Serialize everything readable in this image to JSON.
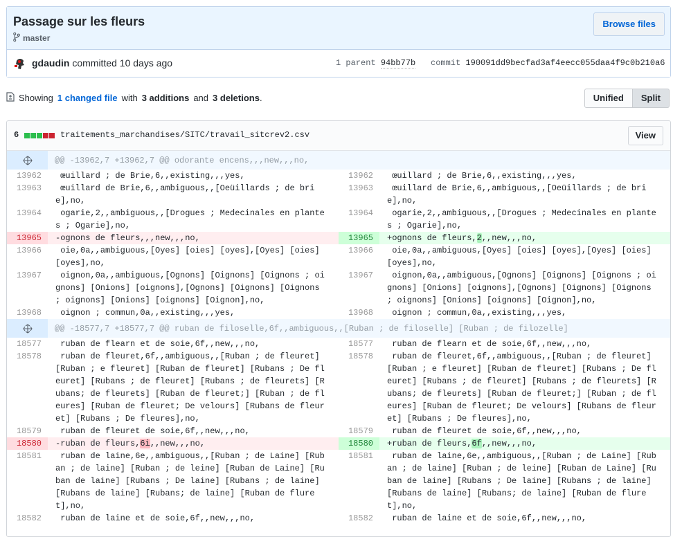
{
  "commit": {
    "title": "Passage sur les fleurs",
    "branch": "master",
    "browse_label": "Browse files",
    "author": "gdaudin",
    "committed_text": "committed 10 days ago",
    "parent_label": "1 parent",
    "parent_sha": "94bb77b",
    "commit_label": "commit",
    "commit_sha": "190091dd9becfad3af4eecc055daa4f9c0b210a6"
  },
  "toc": {
    "showing": "Showing",
    "changed": "1 changed file",
    "with": "with",
    "additions": "3 additions",
    "and": "and",
    "deletions": "3 deletions",
    "period": ".",
    "unified_label": "Unified",
    "split_label": "Split"
  },
  "file": {
    "count": "6",
    "path": "traitements_marchandises/SITC/travail_sitcrev2.csv",
    "view_label": "View",
    "diffstat_colors": [
      "#2cbe4e",
      "#2cbe4e",
      "#2cbe4e",
      "#cb2431",
      "#cb2431"
    ]
  },
  "hunk1": {
    "header": "@@ -13962,7 +13962,7 @@ odorante encens,,,new,,,no,",
    "rows": [
      {
        "ln": "13962",
        "l": " œuillard ; de Brie,6,,existing,,,yes,",
        "r": " œuillard ; de Brie,6,,existing,,,yes,"
      },
      {
        "ln": "13963",
        "l": " œuillard de Brie,6,,ambiguous,,[Oeüillards ; de brie],no,",
        "r": " œuillard de Brie,6,,ambiguous,,[Oeüillards ; de brie],no,"
      },
      {
        "ln": "13964",
        "l": " ogarie,2,,ambiguous,,[Drogues ; Medecinales en plantes ; Ogarie],no,",
        "r": " ogarie,2,,ambiguous,,[Drogues ; Medecinales en plantes ; Ogarie],no,"
      },
      {
        "ln": "13965",
        "pre": "-ognons de fleurs,",
        "hl": "",
        "post": ",,new,,,no,",
        "rpre": "+ognons de fleurs,",
        "rhl": "2",
        "rpost": ",,new,,,no,"
      },
      {
        "ln": "13966",
        "l": " oie,0a,,ambiguous,[Oyes] [oies] [oyes],[Oyes] [oies] [oyes],no,",
        "r": " oie,0a,,ambiguous,[Oyes] [oies] [oyes],[Oyes] [oies] [oyes],no,"
      },
      {
        "ln": "13967",
        "l": " oignon,0a,,ambiguous,[Ognons] [Oignons] [Oignons ; oignons] [Onions] [oignons],[Ognons] [Oignons] [Oignons ; oignons] [Onions] [oignons] [Oignon],no,",
        "r": " oignon,0a,,ambiguous,[Ognons] [Oignons] [Oignons ; oignons] [Onions] [oignons],[Ognons] [Oignons] [Oignons ; oignons] [Onions] [oignons] [Oignon],no,"
      },
      {
        "ln": "13968",
        "l": " oignon ; commun,0a,,existing,,,yes,",
        "r": " oignon ; commun,0a,,existing,,,yes,"
      }
    ]
  },
  "hunk2": {
    "header": "@@ -18577,7 +18577,7 @@ ruban de filoselle,6f,,ambiguous,,[Ruban ; de filoselle] [Ruban ; de filozelle]",
    "rows": [
      {
        "ln": "18577",
        "l": " ruban de flearn et de soie,6f,,new,,,no,",
        "r": " ruban de flearn et de soie,6f,,new,,,no,"
      },
      {
        "ln": "18578",
        "l": " ruban de fleuret,6f,,ambiguous,,[Ruban ; de fleuret] [Ruban ; e fleuret] [Ruban de fleuret] [Rubans ; De fleuret] [Rubans ; de fleuret] [Rubans ; de fleurets] [Rubans; de fleurets] [Ruban de fleuret;] [Ruban ; de fleures] [Ruban de fleuret; De velours] [Rubans de fleuret] [Rubans ; De fleures],no,",
        "r": " ruban de fleuret,6f,,ambiguous,,[Ruban ; de fleuret] [Ruban ; e fleuret] [Ruban de fleuret] [Rubans ; De fleuret] [Rubans ; de fleuret] [Rubans ; de fleurets] [Rubans; de fleurets] [Ruban de fleuret;] [Ruban ; de fleures] [Ruban de fleuret; De velours] [Rubans de fleuret] [Rubans ; De fleures],no,"
      },
      {
        "ln": "18579",
        "l": " ruban de fleuret de soie,6f,,new,,,no,",
        "r": " ruban de fleuret de soie,6f,,new,,,no,"
      },
      {
        "ln": "18580",
        "pre": "-ruban de fleurs,",
        "hl": "6i",
        "post": ",,new,,,no,",
        "rpre": "+ruban de fleurs,",
        "rhl": "6f",
        "rpost": ",,new,,,no,"
      },
      {
        "ln": "18581",
        "l": " ruban de laine,6e,,ambiguous,,[Ruban ; de Laine] [Ruban ; de laine] [Ruban ; de leine] [Ruban de Laine] [Ruban de laine] [Rubans ; De laine] [Rubans ; de laine] [Rubans de laine] [Rubans; de laine] [Ruban de fluret],no,",
        "r": " ruban de laine,6e,,ambiguous,,[Ruban ; de Laine] [Ruban ; de laine] [Ruban ; de leine] [Ruban de Laine] [Ruban de laine] [Rubans ; De laine] [Rubans ; de laine] [Rubans de laine] [Rubans; de laine] [Ruban de fluret],no,"
      },
      {
        "ln": "18582",
        "l": " ruban de laine et de soie,6f,,new,,,no,",
        "r": " ruban de laine et de soie,6f,,new,,,no,"
      }
    ]
  }
}
